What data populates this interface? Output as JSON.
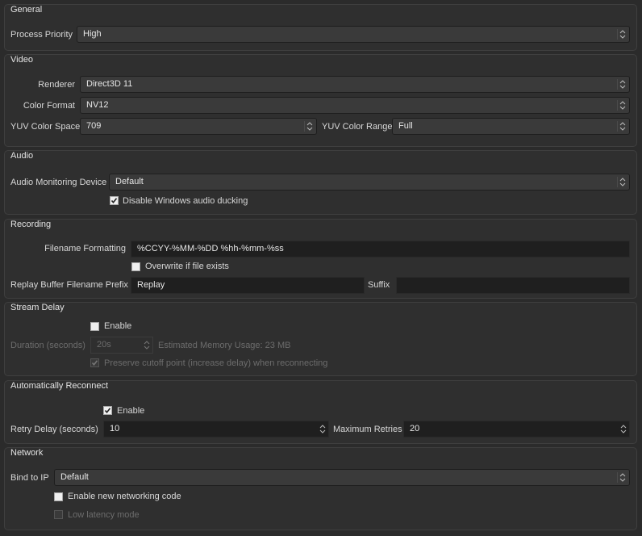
{
  "general": {
    "title": "General",
    "process_priority_label": "Process Priority",
    "process_priority_value": "High"
  },
  "video": {
    "title": "Video",
    "renderer_label": "Renderer",
    "renderer_value": "Direct3D 11",
    "color_format_label": "Color Format",
    "color_format_value": "NV12",
    "color_space_label": "YUV Color Space",
    "color_space_value": "709",
    "color_range_label": "YUV Color Range",
    "color_range_value": "Full"
  },
  "audio": {
    "title": "Audio",
    "monitoring_label": "Audio Monitoring Device",
    "monitoring_value": "Default",
    "ducking_label": "Disable Windows audio ducking",
    "ducking_checked": true
  },
  "recording": {
    "title": "Recording",
    "filename_label": "Filename Formatting",
    "filename_value": "%CCYY-%MM-%DD %hh-%mm-%ss",
    "overwrite_label": "Overwrite if file exists",
    "overwrite_checked": false,
    "replay_prefix_label": "Replay Buffer Filename Prefix",
    "replay_prefix_value": "Replay",
    "suffix_label": "Suffix",
    "suffix_value": ""
  },
  "stream_delay": {
    "title": "Stream Delay",
    "enable_label": "Enable",
    "enable_checked": false,
    "duration_label": "Duration (seconds)",
    "duration_value": "20s",
    "memory_label": "Estimated Memory Usage: 23 MB",
    "preserve_label": "Preserve cutoff point (increase delay) when reconnecting",
    "preserve_checked": true
  },
  "reconnect": {
    "title": "Automatically Reconnect",
    "enable_label": "Enable",
    "enable_checked": true,
    "retry_delay_label": "Retry Delay (seconds)",
    "retry_delay_value": "10",
    "max_retries_label": "Maximum Retries",
    "max_retries_value": "20"
  },
  "network": {
    "title": "Network",
    "bind_label": "Bind to IP",
    "bind_value": "Default",
    "new_code_label": "Enable new networking code",
    "new_code_checked": false,
    "low_latency_label": "Low latency mode",
    "low_latency_checked": false
  }
}
